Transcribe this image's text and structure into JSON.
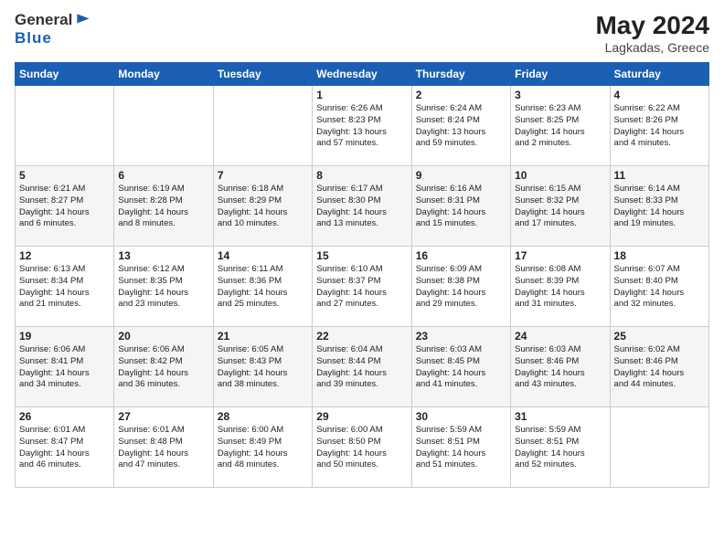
{
  "header": {
    "logo_line1": "General",
    "logo_line2": "Blue",
    "month_year": "May 2024",
    "location": "Lagkadas, Greece"
  },
  "weekdays": [
    "Sunday",
    "Monday",
    "Tuesday",
    "Wednesday",
    "Thursday",
    "Friday",
    "Saturday"
  ],
  "weeks": [
    [
      {
        "day": "",
        "info": ""
      },
      {
        "day": "",
        "info": ""
      },
      {
        "day": "",
        "info": ""
      },
      {
        "day": "1",
        "info": "Sunrise: 6:26 AM\nSunset: 8:23 PM\nDaylight: 13 hours\nand 57 minutes."
      },
      {
        "day": "2",
        "info": "Sunrise: 6:24 AM\nSunset: 8:24 PM\nDaylight: 13 hours\nand 59 minutes."
      },
      {
        "day": "3",
        "info": "Sunrise: 6:23 AM\nSunset: 8:25 PM\nDaylight: 14 hours\nand 2 minutes."
      },
      {
        "day": "4",
        "info": "Sunrise: 6:22 AM\nSunset: 8:26 PM\nDaylight: 14 hours\nand 4 minutes."
      }
    ],
    [
      {
        "day": "5",
        "info": "Sunrise: 6:21 AM\nSunset: 8:27 PM\nDaylight: 14 hours\nand 6 minutes."
      },
      {
        "day": "6",
        "info": "Sunrise: 6:19 AM\nSunset: 8:28 PM\nDaylight: 14 hours\nand 8 minutes."
      },
      {
        "day": "7",
        "info": "Sunrise: 6:18 AM\nSunset: 8:29 PM\nDaylight: 14 hours\nand 10 minutes."
      },
      {
        "day": "8",
        "info": "Sunrise: 6:17 AM\nSunset: 8:30 PM\nDaylight: 14 hours\nand 13 minutes."
      },
      {
        "day": "9",
        "info": "Sunrise: 6:16 AM\nSunset: 8:31 PM\nDaylight: 14 hours\nand 15 minutes."
      },
      {
        "day": "10",
        "info": "Sunrise: 6:15 AM\nSunset: 8:32 PM\nDaylight: 14 hours\nand 17 minutes."
      },
      {
        "day": "11",
        "info": "Sunrise: 6:14 AM\nSunset: 8:33 PM\nDaylight: 14 hours\nand 19 minutes."
      }
    ],
    [
      {
        "day": "12",
        "info": "Sunrise: 6:13 AM\nSunset: 8:34 PM\nDaylight: 14 hours\nand 21 minutes."
      },
      {
        "day": "13",
        "info": "Sunrise: 6:12 AM\nSunset: 8:35 PM\nDaylight: 14 hours\nand 23 minutes."
      },
      {
        "day": "14",
        "info": "Sunrise: 6:11 AM\nSunset: 8:36 PM\nDaylight: 14 hours\nand 25 minutes."
      },
      {
        "day": "15",
        "info": "Sunrise: 6:10 AM\nSunset: 8:37 PM\nDaylight: 14 hours\nand 27 minutes."
      },
      {
        "day": "16",
        "info": "Sunrise: 6:09 AM\nSunset: 8:38 PM\nDaylight: 14 hours\nand 29 minutes."
      },
      {
        "day": "17",
        "info": "Sunrise: 6:08 AM\nSunset: 8:39 PM\nDaylight: 14 hours\nand 31 minutes."
      },
      {
        "day": "18",
        "info": "Sunrise: 6:07 AM\nSunset: 8:40 PM\nDaylight: 14 hours\nand 32 minutes."
      }
    ],
    [
      {
        "day": "19",
        "info": "Sunrise: 6:06 AM\nSunset: 8:41 PM\nDaylight: 14 hours\nand 34 minutes."
      },
      {
        "day": "20",
        "info": "Sunrise: 6:06 AM\nSunset: 8:42 PM\nDaylight: 14 hours\nand 36 minutes."
      },
      {
        "day": "21",
        "info": "Sunrise: 6:05 AM\nSunset: 8:43 PM\nDaylight: 14 hours\nand 38 minutes."
      },
      {
        "day": "22",
        "info": "Sunrise: 6:04 AM\nSunset: 8:44 PM\nDaylight: 14 hours\nand 39 minutes."
      },
      {
        "day": "23",
        "info": "Sunrise: 6:03 AM\nSunset: 8:45 PM\nDaylight: 14 hours\nand 41 minutes."
      },
      {
        "day": "24",
        "info": "Sunrise: 6:03 AM\nSunset: 8:46 PM\nDaylight: 14 hours\nand 43 minutes."
      },
      {
        "day": "25",
        "info": "Sunrise: 6:02 AM\nSunset: 8:46 PM\nDaylight: 14 hours\nand 44 minutes."
      }
    ],
    [
      {
        "day": "26",
        "info": "Sunrise: 6:01 AM\nSunset: 8:47 PM\nDaylight: 14 hours\nand 46 minutes."
      },
      {
        "day": "27",
        "info": "Sunrise: 6:01 AM\nSunset: 8:48 PM\nDaylight: 14 hours\nand 47 minutes."
      },
      {
        "day": "28",
        "info": "Sunrise: 6:00 AM\nSunset: 8:49 PM\nDaylight: 14 hours\nand 48 minutes."
      },
      {
        "day": "29",
        "info": "Sunrise: 6:00 AM\nSunset: 8:50 PM\nDaylight: 14 hours\nand 50 minutes."
      },
      {
        "day": "30",
        "info": "Sunrise: 5:59 AM\nSunset: 8:51 PM\nDaylight: 14 hours\nand 51 minutes."
      },
      {
        "day": "31",
        "info": "Sunrise: 5:59 AM\nSunset: 8:51 PM\nDaylight: 14 hours\nand 52 minutes."
      },
      {
        "day": "",
        "info": ""
      }
    ]
  ]
}
